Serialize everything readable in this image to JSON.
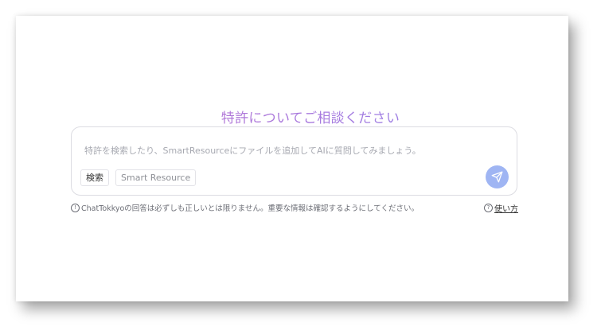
{
  "headline": "特許についてご相談ください",
  "chat": {
    "placeholder": "特許を検索したり、SmartResourceにファイルを追加してAIに質問してみましょう。",
    "value": ""
  },
  "chips": {
    "search": "検索",
    "smart_resource": "Smart Resource"
  },
  "disclaimer": "ChatTokkyoの回答は必ずしも正しいとは限りません。重要な情報は確認するようにしてください。",
  "help": {
    "label": "使い方"
  },
  "icons": {
    "info": "info-circle-icon",
    "help": "question-circle-icon",
    "send": "paper-plane-icon"
  },
  "colors": {
    "accent": "#9fb5f3",
    "headline_gradient_start": "#c26cc8",
    "headline_gradient_end": "#8a8fee"
  }
}
